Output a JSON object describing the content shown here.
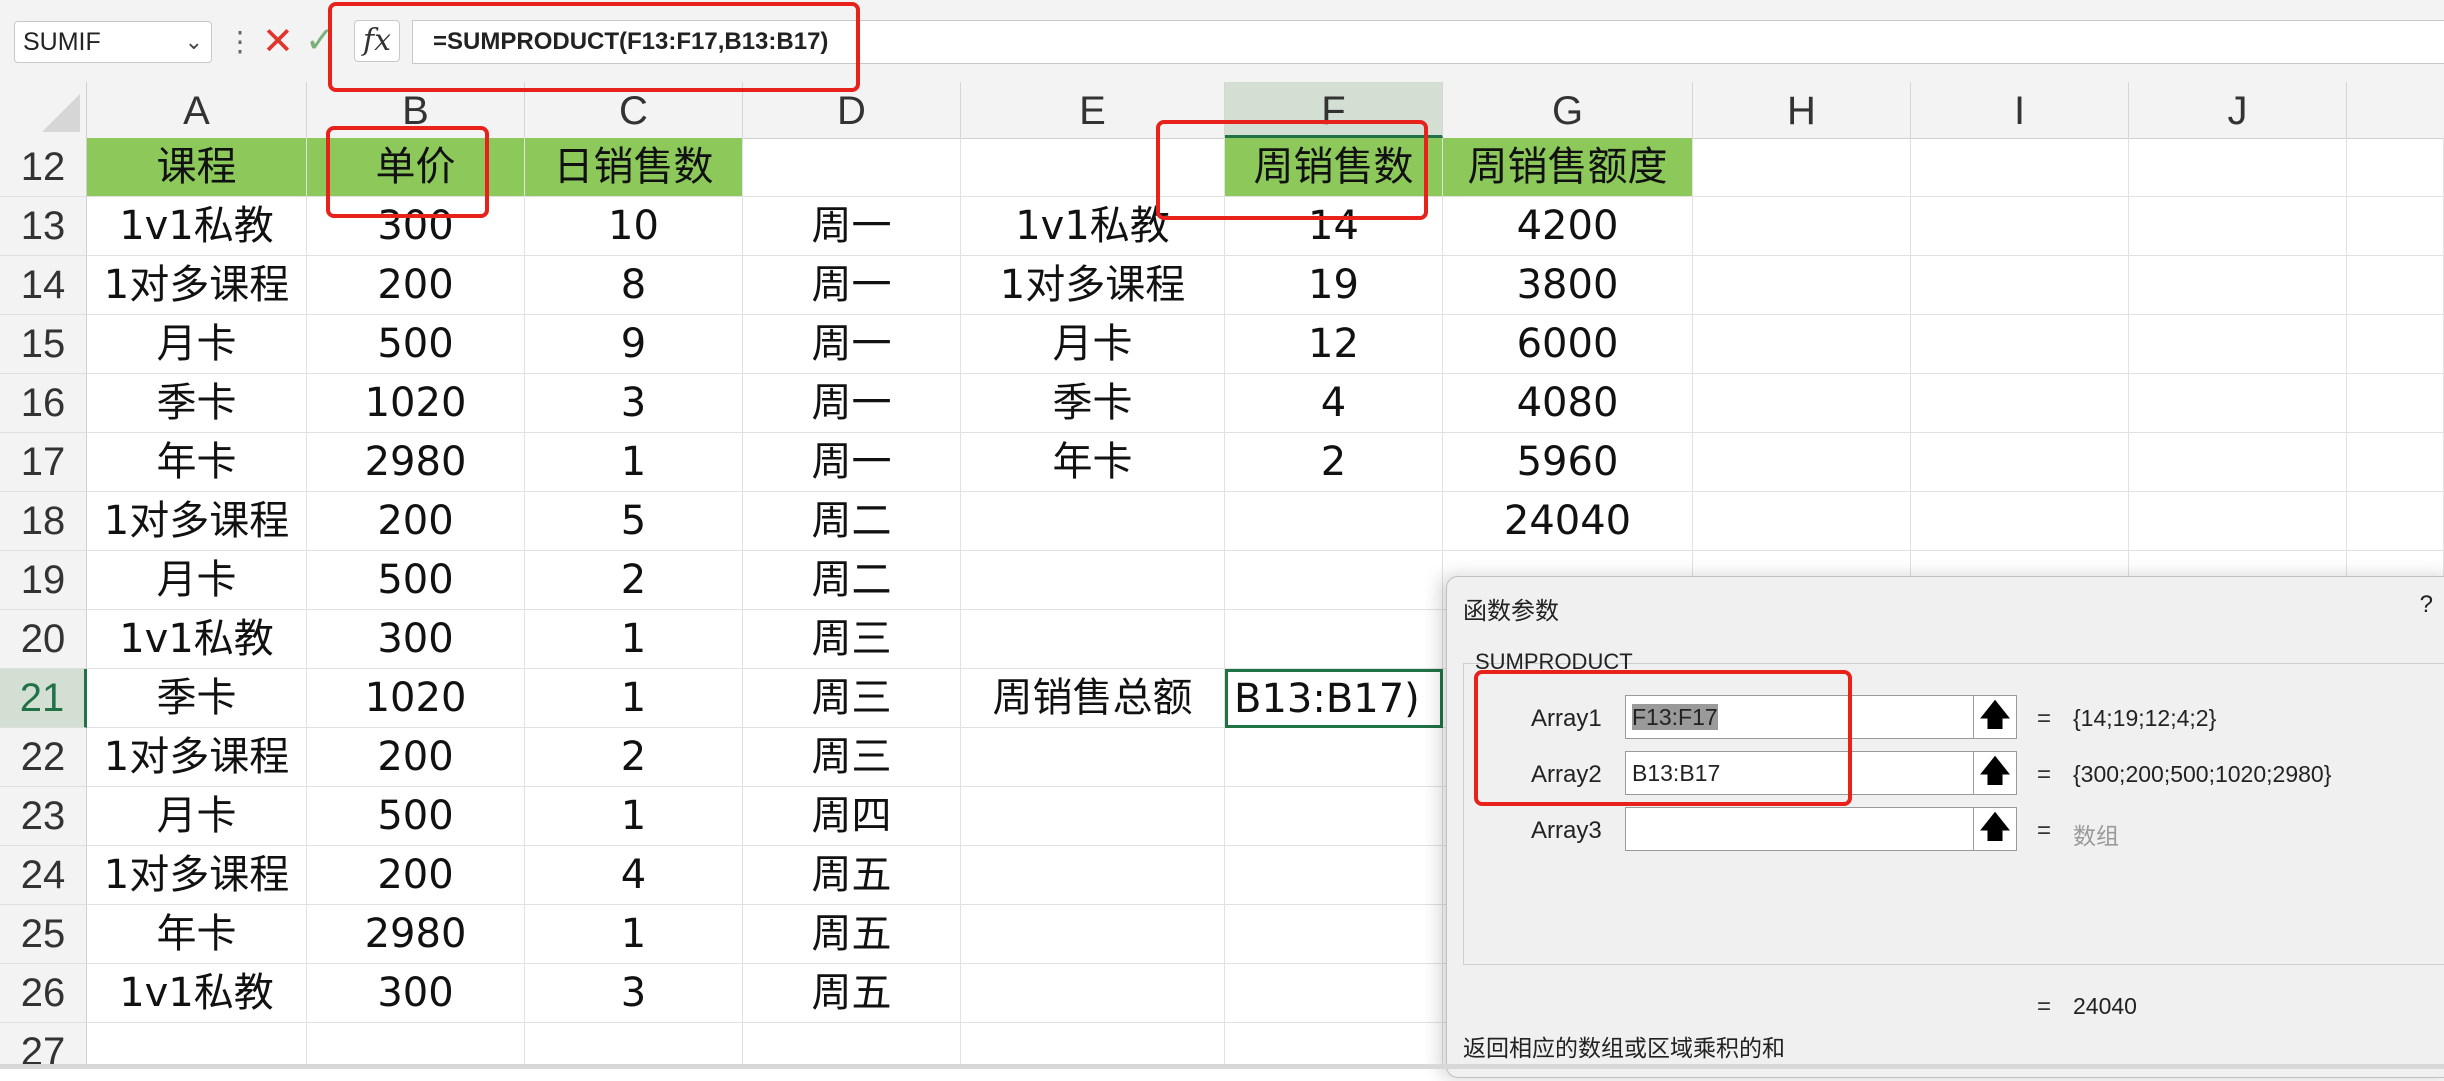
{
  "formula_bar": {
    "name_box": "SUMIF",
    "chevron_icon": "chevron-down-icon",
    "more_icon": "vertical-dots-icon",
    "cancel_icon": "✕",
    "confirm_icon": "✓",
    "fx_label": "fx",
    "formula": "=SUMPRODUCT(F13:F17,B13:B17)"
  },
  "columns": [
    "A",
    "B",
    "C",
    "D",
    "E",
    "F",
    "G",
    "H",
    "I",
    "J"
  ],
  "active_column": "F",
  "row_numbers": [
    "12",
    "13",
    "14",
    "15",
    "16",
    "17",
    "18",
    "19",
    "20",
    "21",
    "22",
    "23",
    "24",
    "25",
    "26",
    "27"
  ],
  "active_row": "21",
  "table": {
    "headers": [
      "课程",
      "单价",
      "日销售数"
    ],
    "rows": [
      [
        "1v1私教",
        "300",
        "10",
        "周一"
      ],
      [
        "1对多课程",
        "200",
        "8",
        "周一"
      ],
      [
        "月卡",
        "500",
        "9",
        "周一"
      ],
      [
        "季卡",
        "1020",
        "3",
        "周一"
      ],
      [
        "年卡",
        "2980",
        "1",
        "周一"
      ],
      [
        "1对多课程",
        "200",
        "5",
        "周二"
      ],
      [
        "月卡",
        "500",
        "2",
        "周二"
      ],
      [
        "1v1私教",
        "300",
        "1",
        "周三"
      ],
      [
        "季卡",
        "1020",
        "1",
        "周三"
      ],
      [
        "1对多课程",
        "200",
        "2",
        "周三"
      ],
      [
        "月卡",
        "500",
        "1",
        "周四"
      ],
      [
        "1对多课程",
        "200",
        "4",
        "周五"
      ],
      [
        "年卡",
        "2980",
        "1",
        "周五"
      ],
      [
        "1v1私教",
        "300",
        "3",
        "周五"
      ]
    ]
  },
  "summary": {
    "headers": [
      "周销售数",
      "周销售额度"
    ],
    "rows": [
      [
        "1v1私教",
        "14",
        "4200"
      ],
      [
        "1对多课程",
        "19",
        "3800"
      ],
      [
        "月卡",
        "12",
        "6000"
      ],
      [
        "季卡",
        "4",
        "4080"
      ],
      [
        "年卡",
        "2",
        "5960"
      ]
    ],
    "total_g18": "24040",
    "total_label": "周销售总额",
    "editing_cell": "B13:B17)"
  },
  "colors": {
    "header_green": "#8cc85a",
    "annotation_red": "#e8211b",
    "selection_green": "#217346"
  },
  "dialog": {
    "title": "函数参数",
    "help": "?",
    "function_name": "SUMPRODUCT",
    "args": [
      {
        "label": "Array1",
        "value": "F13:F17",
        "result": "{14;19;12;4;2}"
      },
      {
        "label": "Array2",
        "value": "B13:B17",
        "result": "{300;200;500;1020;2980}"
      },
      {
        "label": "Array3",
        "value": "",
        "result": "数组"
      }
    ],
    "ref_icon": "ref-arrow-up-icon",
    "equals": "=",
    "result": "24040",
    "description": "返回相应的数组或区域乘积的和"
  }
}
